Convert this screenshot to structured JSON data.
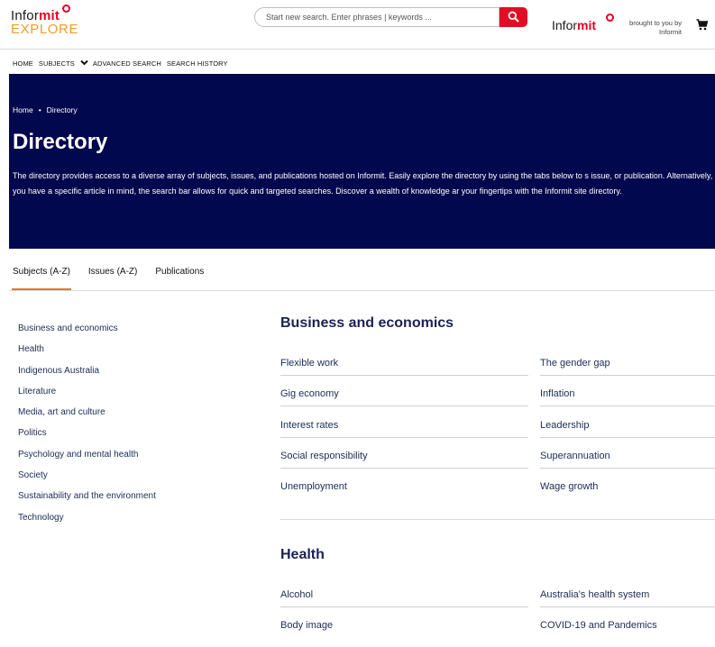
{
  "header": {
    "logo": {
      "line1_a": "Infor",
      "line1_b": "mit",
      "line2": "EXPLORE"
    },
    "search": {
      "placeholder": "Start new search. Enter phrases | keywords ..."
    },
    "brand": {
      "a": "Infor",
      "b": "mit"
    },
    "brought_by": "brought to you by Informit",
    "icons": {
      "search": "search-icon",
      "cart": "cart-icon"
    },
    "colors": {
      "accent": "#e20d25",
      "logo_orange": "#f39b2f"
    }
  },
  "nav": {
    "items": [
      "HOME",
      "SUBJECTS",
      "ADVANCED SEARCH",
      "SEARCH HISTORY"
    ]
  },
  "hero": {
    "breadcrumb": [
      "Home",
      "Directory"
    ],
    "title": "Directory",
    "description": "The directory provides access to a diverse array of subjects, issues, and publications hosted on Informit. Easily explore the directory by using the tabs below to s issue, or publication. Alternatively, if you have a specific article in mind, the search bar allows for quick and targeted searches. Discover a wealth of knowledge ar your fingertips with the Informit site directory.",
    "background": "#02084d"
  },
  "tabs": [
    "Subjects (A-Z)",
    "Issues (A-Z)",
    "Publications"
  ],
  "active_tab": "Subjects (A-Z)",
  "sidebar": {
    "items": [
      "Business and economics",
      "Health",
      "Indigenous Australia",
      "Literature",
      "Media, art and culture",
      "Politics",
      "Psychology and mental health",
      "Society",
      "Sustainability and the environment",
      "Technology"
    ]
  },
  "sections": [
    {
      "title": "Business and economics",
      "rows": [
        [
          "Flexible work",
          "The gender gap"
        ],
        [
          "Gig economy",
          "Inflation"
        ],
        [
          "Interest rates",
          "Leadership"
        ],
        [
          "Social responsibility",
          "Superannuation"
        ],
        [
          "Unemployment",
          "Wage growth"
        ]
      ]
    },
    {
      "title": "Health",
      "rows": [
        [
          "Alcohol",
          "Australia's health system"
        ],
        [
          "Body image",
          "COVID-19 and Pandemics"
        ]
      ]
    }
  ]
}
